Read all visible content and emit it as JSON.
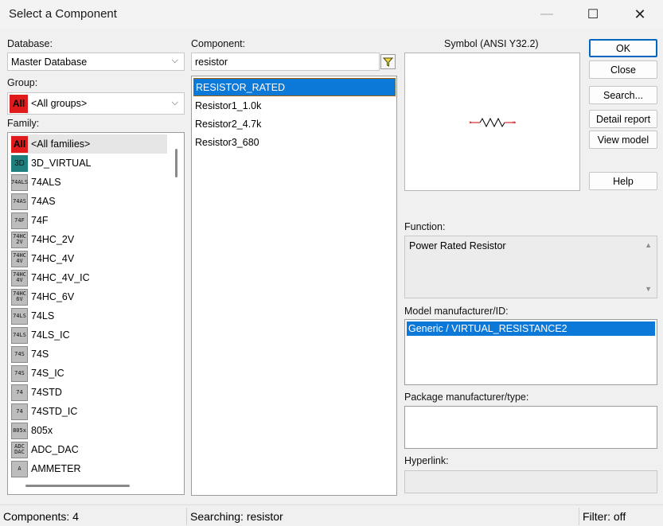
{
  "window": {
    "title": "Select a Component",
    "minimize_glyph": "—",
    "maximize_glyph": "☐",
    "close_glyph": "✕"
  },
  "database": {
    "label": "Database:",
    "value": "Master Database"
  },
  "group": {
    "label": "Group:",
    "value": "<All groups>",
    "icon": "All"
  },
  "family": {
    "label": "Family:",
    "items": [
      {
        "icon": "All",
        "icon_style": "red",
        "label": "<All families>"
      },
      {
        "icon": "3D",
        "icon_style": "teal",
        "label": "3D_VIRTUAL"
      },
      {
        "icon": "74ALS",
        "icon_style": "gray",
        "label": "74ALS"
      },
      {
        "icon": "74AS",
        "icon_style": "gray",
        "label": "74AS"
      },
      {
        "icon": "74F",
        "icon_style": "gray",
        "label": "74F"
      },
      {
        "icon": "74HC 2V",
        "icon_style": "gray",
        "label": "74HC_2V"
      },
      {
        "icon": "74HC 4V",
        "icon_style": "gray",
        "label": "74HC_4V"
      },
      {
        "icon": "74HC 4V",
        "icon_style": "gray",
        "label": "74HC_4V_IC"
      },
      {
        "icon": "74HC 6V",
        "icon_style": "gray",
        "label": "74HC_6V"
      },
      {
        "icon": "74LS",
        "icon_style": "gray",
        "label": "74LS"
      },
      {
        "icon": "74LS",
        "icon_style": "gray",
        "label": "74LS_IC"
      },
      {
        "icon": "74S",
        "icon_style": "gray",
        "label": "74S"
      },
      {
        "icon": "74S",
        "icon_style": "gray",
        "label": "74S_IC"
      },
      {
        "icon": "74",
        "icon_style": "gray",
        "label": "74STD"
      },
      {
        "icon": "74",
        "icon_style": "gray",
        "label": "74STD_IC"
      },
      {
        "icon": "805x",
        "icon_style": "gray",
        "label": "805x"
      },
      {
        "icon": "ADC DAC",
        "icon_style": "gray",
        "label": "ADC_DAC"
      },
      {
        "icon": "A",
        "icon_style": "gray",
        "label": "AMMETER"
      }
    ]
  },
  "component": {
    "label": "Component:",
    "search_value": "resistor",
    "filter_icon": "funnel-icon",
    "items": [
      "RESISTOR_RATED",
      "Resistor1_1.0k",
      "Resistor2_4.7k",
      "Resistor3_680"
    ]
  },
  "symbol": {
    "label": "Symbol (ANSI Y32.2)"
  },
  "buttons": {
    "ok": "OK",
    "close": "Close",
    "search": "Search...",
    "detail_report": "Detail report",
    "view_model": "View model",
    "help": "Help"
  },
  "function": {
    "label": "Function:",
    "value": "Power Rated Resistor"
  },
  "model": {
    "label": "Model manufacturer/ID:",
    "items": [
      "Generic / VIRTUAL_RESISTANCE2"
    ]
  },
  "package": {
    "label": "Package manufacturer/type:"
  },
  "hyperlink": {
    "label": "Hyperlink:"
  },
  "status": {
    "components": "Components: 4",
    "searching": "Searching: resistor",
    "filter": "Filter: off"
  },
  "colors": {
    "selection": "#0c78d7",
    "symbol_red": "#cc0000"
  }
}
